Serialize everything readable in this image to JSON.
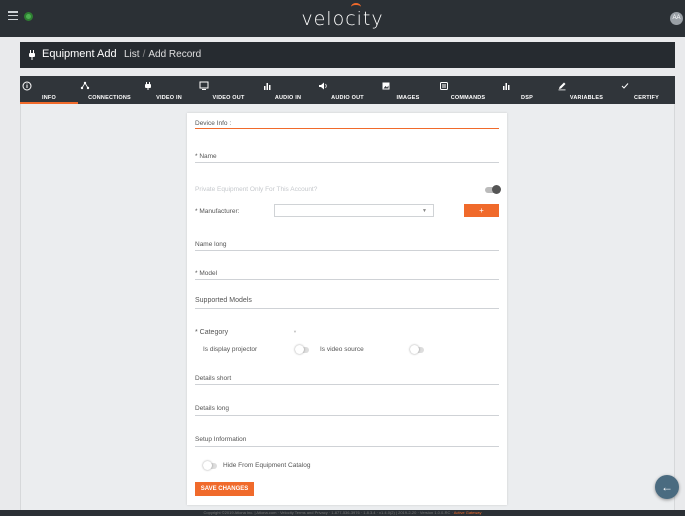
{
  "topbar": {
    "brand": "velocity",
    "avatar": "AA"
  },
  "titlebar": {
    "title": "Equipment Add",
    "crumb_list": "List",
    "crumb_sep": "/",
    "crumb_current": "Add Record"
  },
  "tabs": [
    {
      "label": "INFO",
      "icon": "info-icon",
      "active": true
    },
    {
      "label": "CONNECTIONS",
      "icon": "connections-icon"
    },
    {
      "label": "VIDEO IN",
      "icon": "plug-icon"
    },
    {
      "label": "VIDEO OUT",
      "icon": "monitor-icon"
    },
    {
      "label": "AUDIO IN",
      "icon": "bars-icon"
    },
    {
      "label": "AUDIO OUT",
      "icon": "speaker-icon"
    },
    {
      "label": "IMAGES",
      "icon": "image-icon"
    },
    {
      "label": "COMMANDS",
      "icon": "commands-icon"
    },
    {
      "label": "DSP",
      "icon": "bars-icon"
    },
    {
      "label": "VARIABLES",
      "icon": "pencil-icon"
    },
    {
      "label": "CERTIFY",
      "icon": "check-icon"
    }
  ],
  "form": {
    "device_info": "Device Info :",
    "name": "* Name",
    "private_label": "Private Equipment Only For This Account?",
    "manufacturer": "* Manufacturer:",
    "plus": "+",
    "name_long": "Name long",
    "model": "* Model",
    "supported_models": "Supported Models",
    "category": "* Category",
    "is_display_projector": "Is display projector",
    "is_video_source": "Is video source",
    "details_short": "Details short",
    "details_long": "Details long",
    "setup_information": "Setup Information",
    "hide_catalog": "Hide From Equipment Catalog",
    "save": "SAVE CHANGES"
  },
  "footer": {
    "text": "Copyright ©2019 Atlona Inc. | Atlona.com · Velocity Terms and Privacy · 1-877-536-3976 · 1.8.3.4 ·  v1.4.0(2) | 2019-2-20 · Version 1.0.0-RC · ",
    "accent": "Active Gateway"
  },
  "colors": {
    "accent": "#f06a2b",
    "dark": "#2b3035"
  }
}
